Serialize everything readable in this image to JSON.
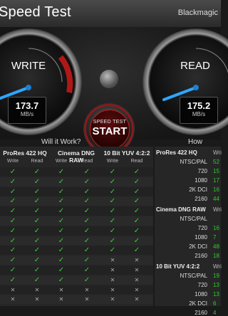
{
  "window": {
    "title": "Speed Test",
    "brand": "Blackmagic"
  },
  "gauges": {
    "write": {
      "label": "WRITE",
      "value": "173.7",
      "unit": "MB/s"
    },
    "read": {
      "label": "READ",
      "value": "175.2",
      "unit": "MB/s"
    }
  },
  "start": {
    "line1": "SPEED TEST",
    "line2": "START"
  },
  "sections": {
    "will_it_work": "Will it Work?",
    "how_fast": "How Fast?"
  },
  "formats": [
    {
      "name": "ProRes 422 HQ",
      "write": "Write",
      "read": "Read"
    },
    {
      "name": "Cinema DNG RAW",
      "write": "Write",
      "read": "Read"
    },
    {
      "name": "10 Bit YUV 4:2:2",
      "write": "Write",
      "read": "Read"
    }
  ],
  "icons": {
    "yes": "✓",
    "no": "✕"
  },
  "grid_rows": [
    [
      1,
      1,
      1,
      1,
      1,
      1
    ],
    [
      1,
      1,
      1,
      1,
      1,
      1
    ],
    [
      1,
      1,
      1,
      1,
      1,
      1
    ],
    [
      1,
      1,
      1,
      1,
      1,
      1
    ],
    [
      1,
      1,
      1,
      1,
      1,
      1
    ],
    [
      1,
      1,
      1,
      1,
      1,
      1
    ],
    [
      1,
      1,
      1,
      1,
      1,
      1
    ],
    [
      1,
      1,
      1,
      1,
      1,
      1
    ],
    [
      1,
      1,
      1,
      1,
      1,
      1
    ],
    [
      1,
      1,
      1,
      1,
      0,
      0
    ],
    [
      1,
      1,
      1,
      1,
      0,
      0
    ],
    [
      1,
      1,
      1,
      1,
      0,
      0
    ],
    [
      0,
      0,
      0,
      0,
      0,
      0
    ],
    [
      0,
      0,
      0,
      0,
      0,
      0
    ]
  ],
  "how_fast": [
    {
      "group": "ProRes 422 HQ",
      "col": "Wri",
      "rows": [
        {
          "label": "NTSC/PAL",
          "val": "52"
        },
        {
          "label": "720",
          "val": "15"
        },
        {
          "label": "1080",
          "val": "17"
        },
        {
          "label": "2K DCI",
          "val": "16"
        },
        {
          "label": "2160",
          "val": "44"
        }
      ]
    },
    {
      "group": "Cinema DNG RAW",
      "col": "Wri",
      "rows": [
        {
          "label": "NTSC/PAL",
          "val": ""
        },
        {
          "label": "720",
          "val": "16"
        },
        {
          "label": "1080",
          "val": "7"
        },
        {
          "label": "2K DCI",
          "val": "48"
        },
        {
          "label": "2160",
          "val": "18"
        }
      ]
    },
    {
      "group": "10 Bit YUV 4:2:2",
      "col": "Wri",
      "rows": [
        {
          "label": "NTSC/PAL",
          "val": "19"
        },
        {
          "label": "720",
          "val": "13"
        },
        {
          "label": "1080",
          "val": "13"
        },
        {
          "label": "2K DCI",
          "val": "6"
        },
        {
          "label": "2160",
          "val": "4"
        }
      ]
    }
  ]
}
